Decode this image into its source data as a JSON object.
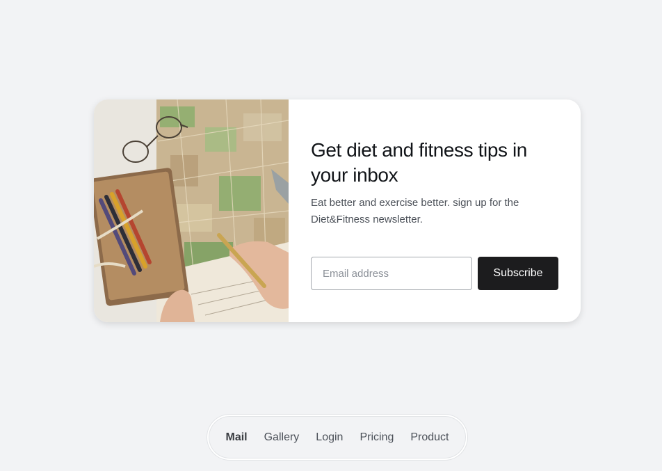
{
  "signup": {
    "title": "Get diet and fitness tips in your inbox",
    "subtitle": "Eat better and exercise better. sign up for the Diet&Fitness newsletter.",
    "email_placeholder": "Email address",
    "email_value": "",
    "subscribe_label": "Subscribe"
  },
  "nav": {
    "items": [
      {
        "label": "Mail",
        "active": true
      },
      {
        "label": "Gallery",
        "active": false
      },
      {
        "label": "Login",
        "active": false
      },
      {
        "label": "Pricing",
        "active": false
      },
      {
        "label": "Product",
        "active": false
      }
    ]
  },
  "colors": {
    "background": "#f2f3f5",
    "card": "#ffffff",
    "button": "#1c1c1e"
  }
}
